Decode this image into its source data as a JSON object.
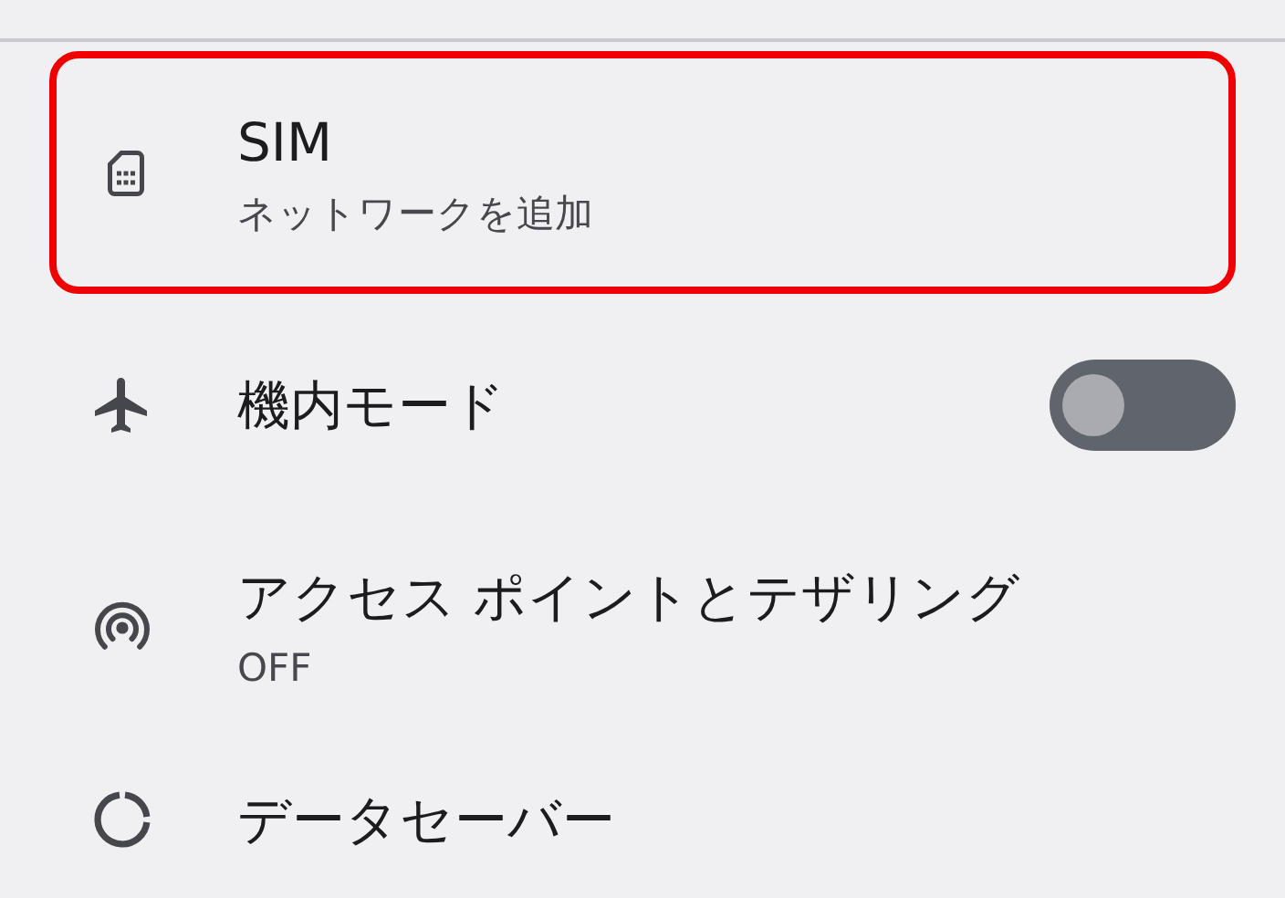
{
  "rows": [
    {
      "kind": "plain",
      "title": "SIM",
      "subtitle": "ネットワークを追加",
      "highlighted": true
    },
    {
      "kind": "switch",
      "title": "機内モード",
      "on": false,
      "highlighted": false
    },
    {
      "kind": "plain",
      "title": "アクセス ポイントとテザリング",
      "subtitle": "OFF",
      "highlighted": false
    },
    {
      "kind": "plain",
      "title": "データセーバー",
      "highlighted": false
    }
  ]
}
